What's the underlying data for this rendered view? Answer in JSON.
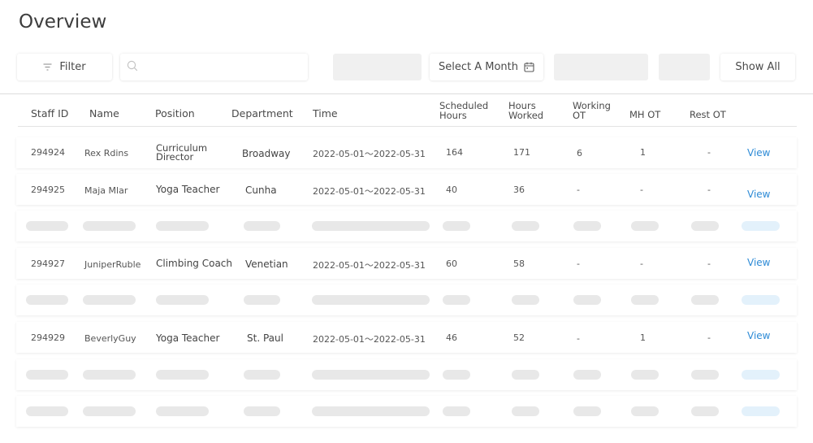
{
  "page": {
    "title": "Overview"
  },
  "toolbar": {
    "filter_label": "Filter",
    "search_placeholder": "",
    "month_label": "Select A Month",
    "show_all_label": "Show All"
  },
  "table": {
    "headers": {
      "staff_id": "Staff ID",
      "name": "Name",
      "position": "Position",
      "department": "Department",
      "time": "Time",
      "scheduled_hours": [
        "Scheduled",
        "Hours"
      ],
      "hours_worked": [
        "Hours",
        "Worked"
      ],
      "working_ot": [
        "Working",
        "OT"
      ],
      "mh_ot": "MH OT",
      "rest_ot": "Rest OT"
    },
    "rows": [
      {
        "id": "294924",
        "name": "Rex Rdins",
        "position": [
          "Curriculum",
          "Director"
        ],
        "department": "Broadway",
        "time": "2022-05-01～2022-05-31",
        "scheduled": "164",
        "worked": "171",
        "working_ot": "6",
        "mh_ot": "1",
        "rest_ot": "-",
        "action": "View"
      },
      {
        "id": "294925",
        "name": "Maja Mlar",
        "position": "Yoga Teacher",
        "department": "Cunha",
        "time": "2022-05-01～2022-05-31",
        "scheduled": "40",
        "worked": "36",
        "working_ot": "-",
        "mh_ot": "-",
        "rest_ot": "-",
        "action": "View"
      },
      {
        "id": "294927",
        "name": "JuniperRuble",
        "position": "Climbing Coach",
        "department": "Venetian",
        "time": "2022-05-01～2022-05-31",
        "scheduled": "60",
        "worked": "58",
        "working_ot": "-",
        "mh_ot": "-",
        "rest_ot": "-",
        "action": "View"
      },
      {
        "id": "294929",
        "name": "BeverlyGuy",
        "position": "Yoga Teacher",
        "department": "St. Paul",
        "time": "2022-05-01～2022-05-31",
        "scheduled": "46",
        "worked": "52",
        "working_ot": "-",
        "mh_ot": "1",
        "rest_ot": "-",
        "action": "View"
      }
    ]
  },
  "colors": {
    "link": "#2e8bd6",
    "skeleton": "#e8e8e8",
    "skeleton_action": "#e3f1fb"
  },
  "icons": {
    "filter": "filter-lines-icon",
    "search": "search-icon",
    "calendar": "calendar-icon"
  }
}
